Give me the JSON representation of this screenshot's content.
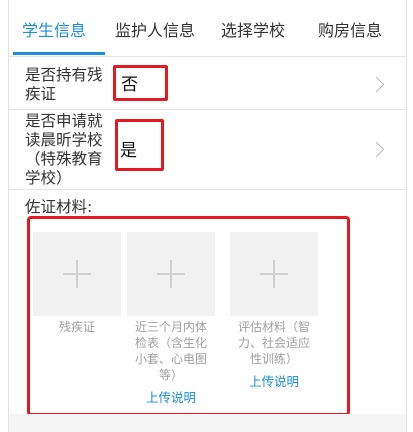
{
  "tabs": [
    {
      "label": "学生信息",
      "active": true
    },
    {
      "label": "监护人信息",
      "active": false
    },
    {
      "label": "选择学校",
      "active": false
    },
    {
      "label": "购房信息",
      "active": false
    }
  ],
  "form": {
    "disability_certificate": {
      "label_line1": "是否持有残",
      "label_line2": "疾证",
      "value": "否"
    },
    "deaf_school": {
      "label_line1": "是否申请就",
      "label_line2": "读晨昕学校",
      "label_line3": "（特殊教育",
      "label_line4": "学校）",
      "value": "是"
    }
  },
  "attachments": {
    "section_label": "佐证材料:",
    "items": [
      {
        "caption_lines": [
          "残疾证"
        ],
        "help_link": ""
      },
      {
        "caption_lines": [
          "近三个月内体",
          "检表（含生化",
          "小套、心电图",
          "等）"
        ],
        "help_link": "上传说明"
      },
      {
        "caption_lines": [
          "评估材料（智",
          "力、社会适应",
          "性训练）"
        ],
        "help_link": "上传说明"
      }
    ]
  },
  "colors": {
    "accent": "#1a8fd8",
    "highlight_border": "#e21b23",
    "tile_background": "#f2f2f2"
  }
}
